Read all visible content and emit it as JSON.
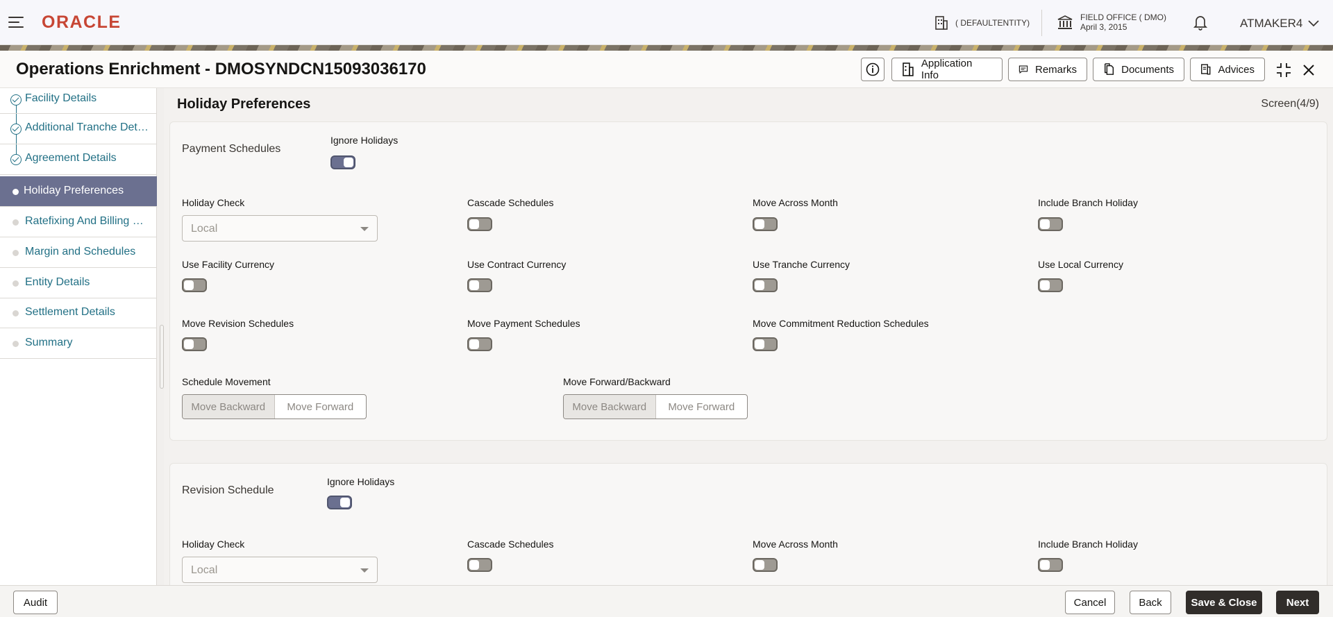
{
  "header": {
    "logo": "ORACLE",
    "entity": "( DEFAULTENTITY)",
    "office_name": "FIELD OFFICE ( DMO)",
    "office_date": "April 3, 2015",
    "user": "ATMAKER4"
  },
  "titlebar": {
    "title": "Operations Enrichment - DMOSYNDCN15093036170",
    "application_info": "Application Info",
    "remarks": "Remarks",
    "documents": "Documents",
    "advices": "Advices"
  },
  "nav": {
    "items": [
      {
        "label": "Facility Details",
        "state": "done"
      },
      {
        "label": "Additional Tranche Details",
        "state": "done"
      },
      {
        "label": "Agreement Details",
        "state": "done"
      },
      {
        "label": "Holiday Preferences",
        "state": "active"
      },
      {
        "label": "Ratefixing And Billing Preferences",
        "state": "pending"
      },
      {
        "label": "Margin and Schedules",
        "state": "pending"
      },
      {
        "label": "Entity Details",
        "state": "pending"
      },
      {
        "label": "Settlement Details",
        "state": "pending"
      },
      {
        "label": "Summary",
        "state": "pending"
      }
    ]
  },
  "main": {
    "section_title": "Holiday Preferences",
    "screen_indicator": "Screen(4/9)",
    "payment": {
      "title": "Payment Schedules",
      "ignore_holidays": {
        "label": "Ignore Holidays",
        "on": true
      },
      "holiday_check": {
        "label": "Holiday Check",
        "value": "Local"
      },
      "cascade_schedules": {
        "label": "Cascade Schedules",
        "on": false
      },
      "move_across_month": {
        "label": "Move Across Month",
        "on": false
      },
      "include_branch_holiday": {
        "label": "Include Branch Holiday",
        "on": false
      },
      "use_facility_currency": {
        "label": "Use Facility Currency",
        "on": false
      },
      "use_contract_currency": {
        "label": "Use Contract Currency",
        "on": false
      },
      "use_tranche_currency": {
        "label": "Use Tranche Currency",
        "on": false
      },
      "use_local_currency": {
        "label": "Use Local Currency",
        "on": false
      },
      "move_revision_schedules": {
        "label": "Move Revision Schedules",
        "on": false
      },
      "move_payment_schedules": {
        "label": "Move Payment Schedules",
        "on": false
      },
      "move_commitment_reduction": {
        "label": "Move Commitment Reduction Schedules",
        "on": false
      },
      "schedule_movement": {
        "label": "Schedule Movement",
        "options": [
          "Move Backward",
          "Move Forward"
        ]
      },
      "move_forward_backward": {
        "label": "Move Forward/Backward",
        "options": [
          "Move Backward",
          "Move Forward"
        ]
      }
    },
    "revision": {
      "title": "Revision Schedule",
      "ignore_holidays": {
        "label": "Ignore Holidays",
        "on": true
      },
      "holiday_check": {
        "label": "Holiday Check",
        "value": "Local"
      },
      "cascade_schedules": {
        "label": "Cascade Schedules",
        "on": false
      },
      "move_across_month": {
        "label": "Move Across Month",
        "on": false
      },
      "include_branch_holiday": {
        "label": "Include Branch Holiday",
        "on": false
      }
    }
  },
  "footer": {
    "audit": "Audit",
    "cancel": "Cancel",
    "back": "Back",
    "save_close": "Save & Close",
    "next": "Next"
  }
}
